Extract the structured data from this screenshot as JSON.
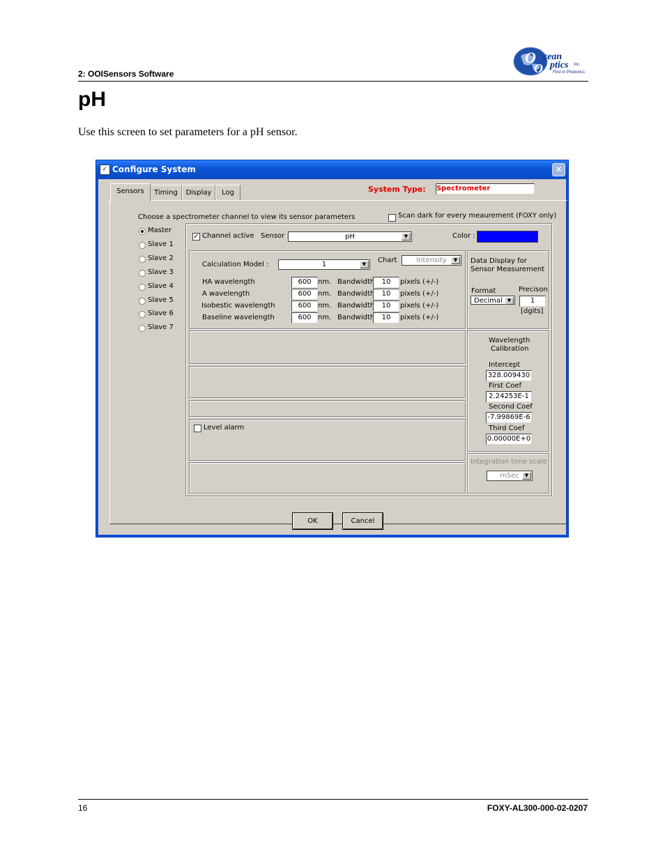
{
  "page_header": {
    "section": "2: OOISensors Software"
  },
  "logo": {
    "line1": "cean",
    "line2": "ptics",
    "inc": "Inc.",
    "tagline": "First in Photonics"
  },
  "title": "pH",
  "intro": "Use this screen to set parameters for a pH sensor.",
  "dialog": {
    "title": "Configure System",
    "close_glyph": "✕",
    "tabs": [
      "Sensors",
      "Timing",
      "Display",
      "Log"
    ],
    "system_type_label": "System Type:",
    "system_type_value": "Spectrometer",
    "choose_label": "Choose a spectrometer channel to view its sensor parameters",
    "scan_dark_label": "Scan dark for every meaurement (FOXY only)",
    "channels": [
      "Master",
      "Slave 1",
      "Slave 2",
      "Slave 3",
      "Slave 4",
      "Slave 5",
      "Slave 6",
      "Slave 7"
    ],
    "selected_channel": "Master",
    "channel_active_label": "Channel active",
    "sensor_label": "Sensor :",
    "sensor_value": "pH",
    "color_label": "Color :",
    "color_value": "#0000ff",
    "calc_model_label": "Calculation Model :",
    "calc_model_value": "1",
    "chart_label": "Chart",
    "chart_value": "Intensity",
    "wavelength_rows": [
      {
        "label": "HA wavelength",
        "value": "600",
        "unit": "nm.",
        "bw_label": "Bandwidth",
        "bw_value": "10",
        "bw_unit": "pixels (+/-)"
      },
      {
        "label": "A wavelength",
        "value": "600",
        "unit": "nm.",
        "bw_label": "Bandwidth",
        "bw_value": "10",
        "bw_unit": "pixels (+/-)"
      },
      {
        "label": "Isobestic wavelength",
        "value": "600",
        "unit": "nm.",
        "bw_label": "Bandwidth",
        "bw_value": "10",
        "bw_unit": "pixels (+/-)"
      },
      {
        "label": "Baseline wavelength",
        "value": "600",
        "unit": "nm.",
        "bw_label": "Bandwidth",
        "bw_value": "10",
        "bw_unit": "pixels (+/-)"
      }
    ],
    "data_display": {
      "heading_line1": "Data Display for",
      "heading_line2": "Sensor Measurement",
      "format_label": "Format",
      "format_value": "Decimal",
      "precision_label": "Precison",
      "precision_value": "1",
      "digits_label": "[dgits]"
    },
    "calibration": {
      "heading_line1": "Wavelength",
      "heading_line2": "Calibration",
      "intercept_label": "Intercept",
      "intercept_value": "328.009430",
      "first_label": "First Coef",
      "first_value": "2.24253E-1",
      "second_label": "Second Coef",
      "second_value": "-7.99869E-6",
      "third_label": "Third Coef",
      "third_value": "0.00000E+0"
    },
    "level_alarm_label": "Level alarm",
    "integration_label": "Integration time scale",
    "integration_value": "mSec",
    "ok_label": "OK",
    "cancel_label": "Cancel"
  },
  "footer": {
    "page_number": "16",
    "doc_id": "FOXY-AL300-000-02-0207"
  }
}
